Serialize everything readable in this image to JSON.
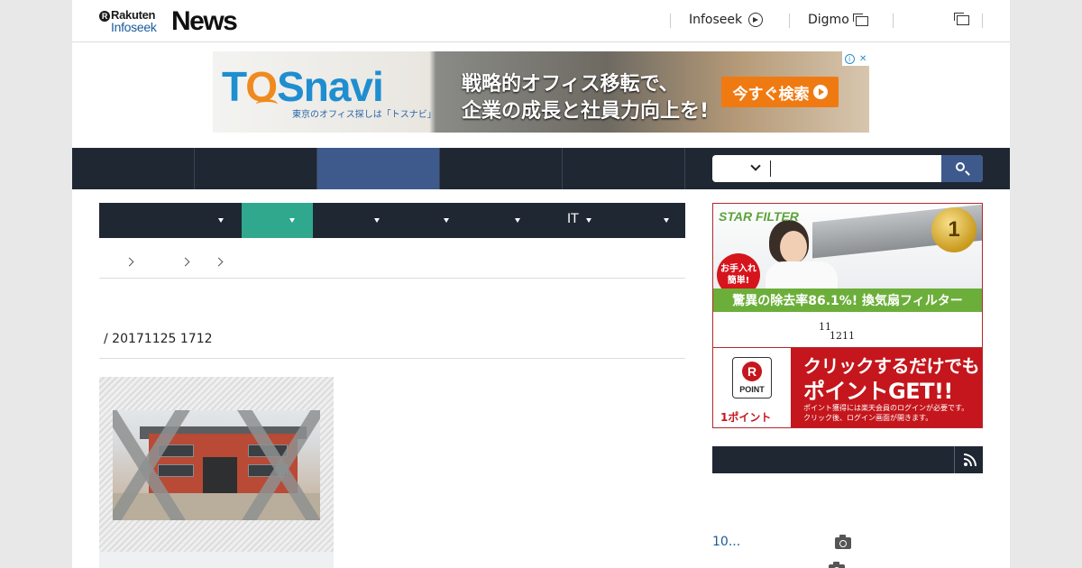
{
  "header": {
    "logo_rakuten": "Rakuten",
    "logo_r": "R",
    "logo_infoseek": "Infoseek",
    "logo_news": "News",
    "links": [
      {
        "label": "Infoseek",
        "icon": "circle-arrow-icon"
      },
      {
        "label": "Digmo",
        "icon": "new-window-icon"
      },
      {
        "label": "",
        "icon": "new-window-icon"
      }
    ]
  },
  "banner_ad": {
    "brand_pre": "T",
    "brand_o": "O",
    "brand_post": "Snavi",
    "tagline": "東京のオフィス探しは「トスナビ」",
    "copy_line1": "戦略的オフィス移転で、",
    "copy_line2": "企業の成長と社員力向上を!",
    "cta": "今すぐ検索",
    "adchoices_i": "i",
    "adchoices_x": "✕"
  },
  "nav": {
    "tabs": [
      "",
      "",
      "",
      "",
      ""
    ],
    "active_index": 2,
    "search_placeholder": ""
  },
  "subnav": {
    "items": [
      {
        "label": ""
      },
      {
        "label": ""
      },
      {
        "label": ""
      },
      {
        "label": ""
      },
      {
        "label": ""
      },
      {
        "label": "IT"
      },
      {
        "label": ""
      }
    ],
    "active_index": 1
  },
  "article": {
    "dateline": "/ 20171125 1712"
  },
  "sidebar": {
    "filter_ad": {
      "brand": "STAR FILTER",
      "badge": "お手入れ簡単!",
      "medal": "1",
      "banner": "驚異の除去率86.1%! 換気扇フィルター"
    },
    "rate": {
      "sup": "11",
      "sub": "1211"
    },
    "point_ad": {
      "r": "R",
      "point_label": "POINT",
      "one_point": "1ポイント",
      "line1": "クリックするだけでも",
      "line2": "ポイントGET!!",
      "line3": "ポイント獲得には楽天会員のログインが必要です。",
      "line4": "クリック後、ログイン画面が開きます。"
    },
    "ranking": [
      {
        "title": "10...",
        "icon": "camera-icon"
      }
    ]
  },
  "colors": {
    "nav_bg": "#1f2733",
    "nav_active": "#3e5a8c",
    "subnav_active": "#2fa88e",
    "link": "#1a5a9a",
    "ad_border": "#b3282d"
  }
}
